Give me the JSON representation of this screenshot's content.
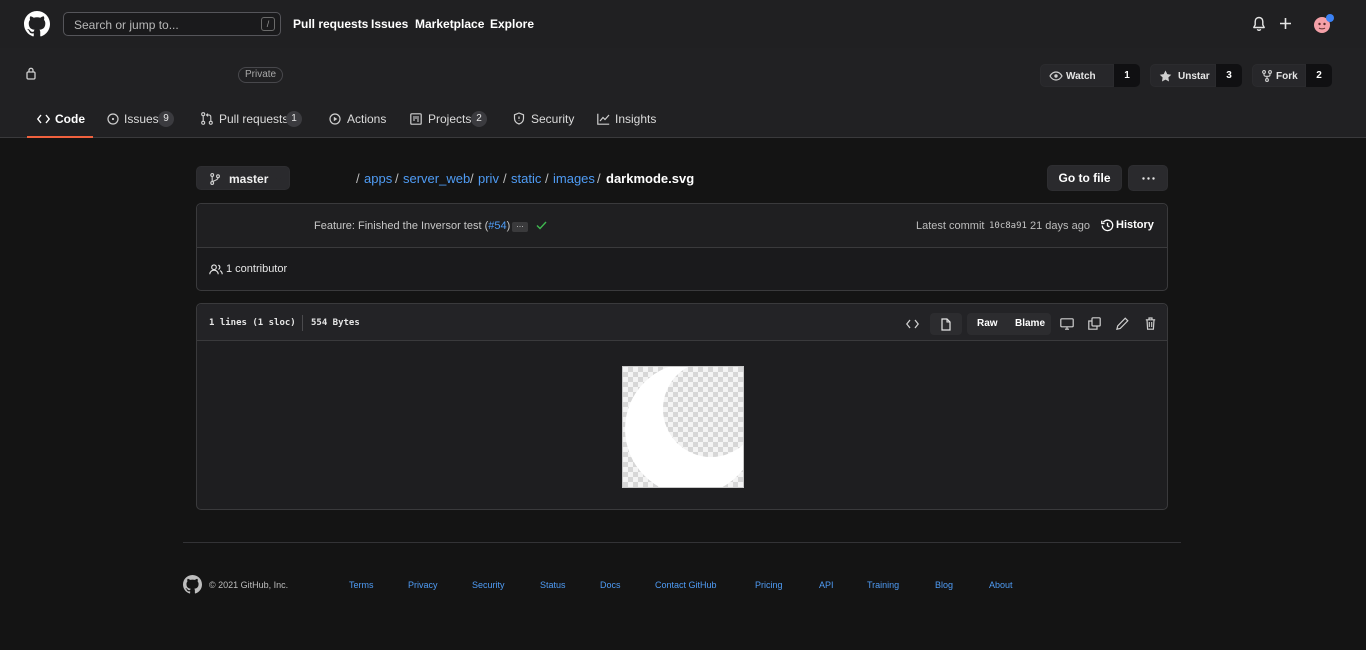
{
  "topnav": {
    "search_placeholder": "Search or jump to...",
    "search_shortcut": "/",
    "links": [
      "Pull requests",
      "Issues",
      "Marketplace",
      "Explore"
    ]
  },
  "repo": {
    "visibility": "Private",
    "watch_label": "Watch",
    "watch_count": "1",
    "star_label": "Unstar",
    "star_count": "3",
    "fork_label": "Fork",
    "fork_count": "2"
  },
  "tabs": [
    {
      "label": "Code",
      "count": ""
    },
    {
      "label": "Issues",
      "count": "9"
    },
    {
      "label": "Pull requests",
      "count": "1"
    },
    {
      "label": "Actions",
      "count": ""
    },
    {
      "label": "Projects",
      "count": "2"
    },
    {
      "label": "Security",
      "count": ""
    },
    {
      "label": "Insights",
      "count": ""
    }
  ],
  "branch": "master",
  "breadcrumb": {
    "parts": [
      "apps",
      "server_web",
      "priv",
      "static",
      "images"
    ],
    "separator": "/",
    "current": "darkmode.svg"
  },
  "buttons": {
    "go_to_file": "Go to file",
    "history": "History",
    "raw": "Raw",
    "blame": "Blame"
  },
  "commit": {
    "message": "Feature: Finished the Inversor test (",
    "pr_link": "#54",
    "message_end": ")",
    "ellipsis": "…",
    "latest_label": "Latest commit",
    "sha": "10c8a91",
    "age": "21 days ago"
  },
  "contributors": "1 contributor",
  "file": {
    "lines": "1 lines (1 sloc)",
    "size": "554 Bytes"
  },
  "footer": {
    "copyright": "© 2021 GitHub, Inc.",
    "links": [
      "Terms",
      "Privacy",
      "Security",
      "Status",
      "Docs",
      "Contact GitHub",
      "Pricing",
      "API",
      "Training",
      "Blog",
      "About"
    ]
  },
  "colors": {
    "accent_link": "#4f9cf5",
    "tab_underline": "#f0613e",
    "check": "#3fb950",
    "notification_dot": "#3b82f6"
  },
  "icons": [
    "github-logo-icon",
    "lock-icon",
    "eye-icon",
    "star-icon",
    "fork-icon",
    "code-icon",
    "issue-icon",
    "pull-request-icon",
    "play-icon",
    "project-icon",
    "shield-icon",
    "graph-icon",
    "branch-icon",
    "history-icon",
    "people-icon",
    "bell-icon",
    "plus-icon",
    "avatar"
  ]
}
